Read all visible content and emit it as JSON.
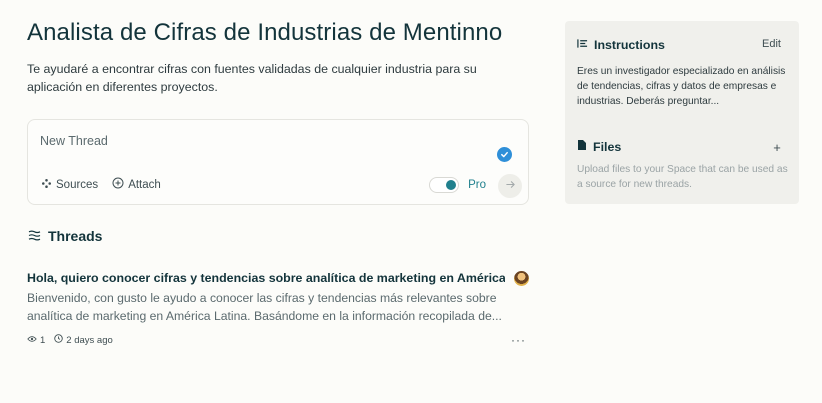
{
  "space": {
    "title": "Analista de Cifras de Industrias de Mentinno",
    "description": "Te ayudaré a encontrar cifras con fuentes validadas de cualquier industria para su aplicación en diferentes proyectos."
  },
  "composer": {
    "placeholder": "New Thread",
    "sources_label": "Sources",
    "attach_label": "Attach",
    "pro_label": "Pro",
    "pro_enabled": true
  },
  "threads": {
    "heading": "Threads",
    "items": [
      {
        "title": "Hola, quiero conocer cifras y tendencias sobre analítica de marketing en América ...",
        "excerpt": "Bienvenido, con gusto le ayudo a conocer las cifras y tendencias más relevantes sobre analítica de marketing en América Latina. Basándome en la información recopilada de...",
        "views": "1",
        "time": "2 days ago",
        "more": "···"
      }
    ]
  },
  "sidebar": {
    "instructions": {
      "label": "Instructions",
      "edit_label": "Edit",
      "text": "Eres un investigador especializado en análisis de tendencias, cifras y datos de empresas e industrias. Deberás preguntar..."
    },
    "files": {
      "label": "Files",
      "add_label": "+",
      "text": "Upload files to your Space that can be used as a source for new threads."
    }
  },
  "colors": {
    "accent": "#20808d",
    "badge_blue": "#2f8fd8",
    "background": "#fcfcf9",
    "sidebar_bg": "#f0f0ec"
  }
}
